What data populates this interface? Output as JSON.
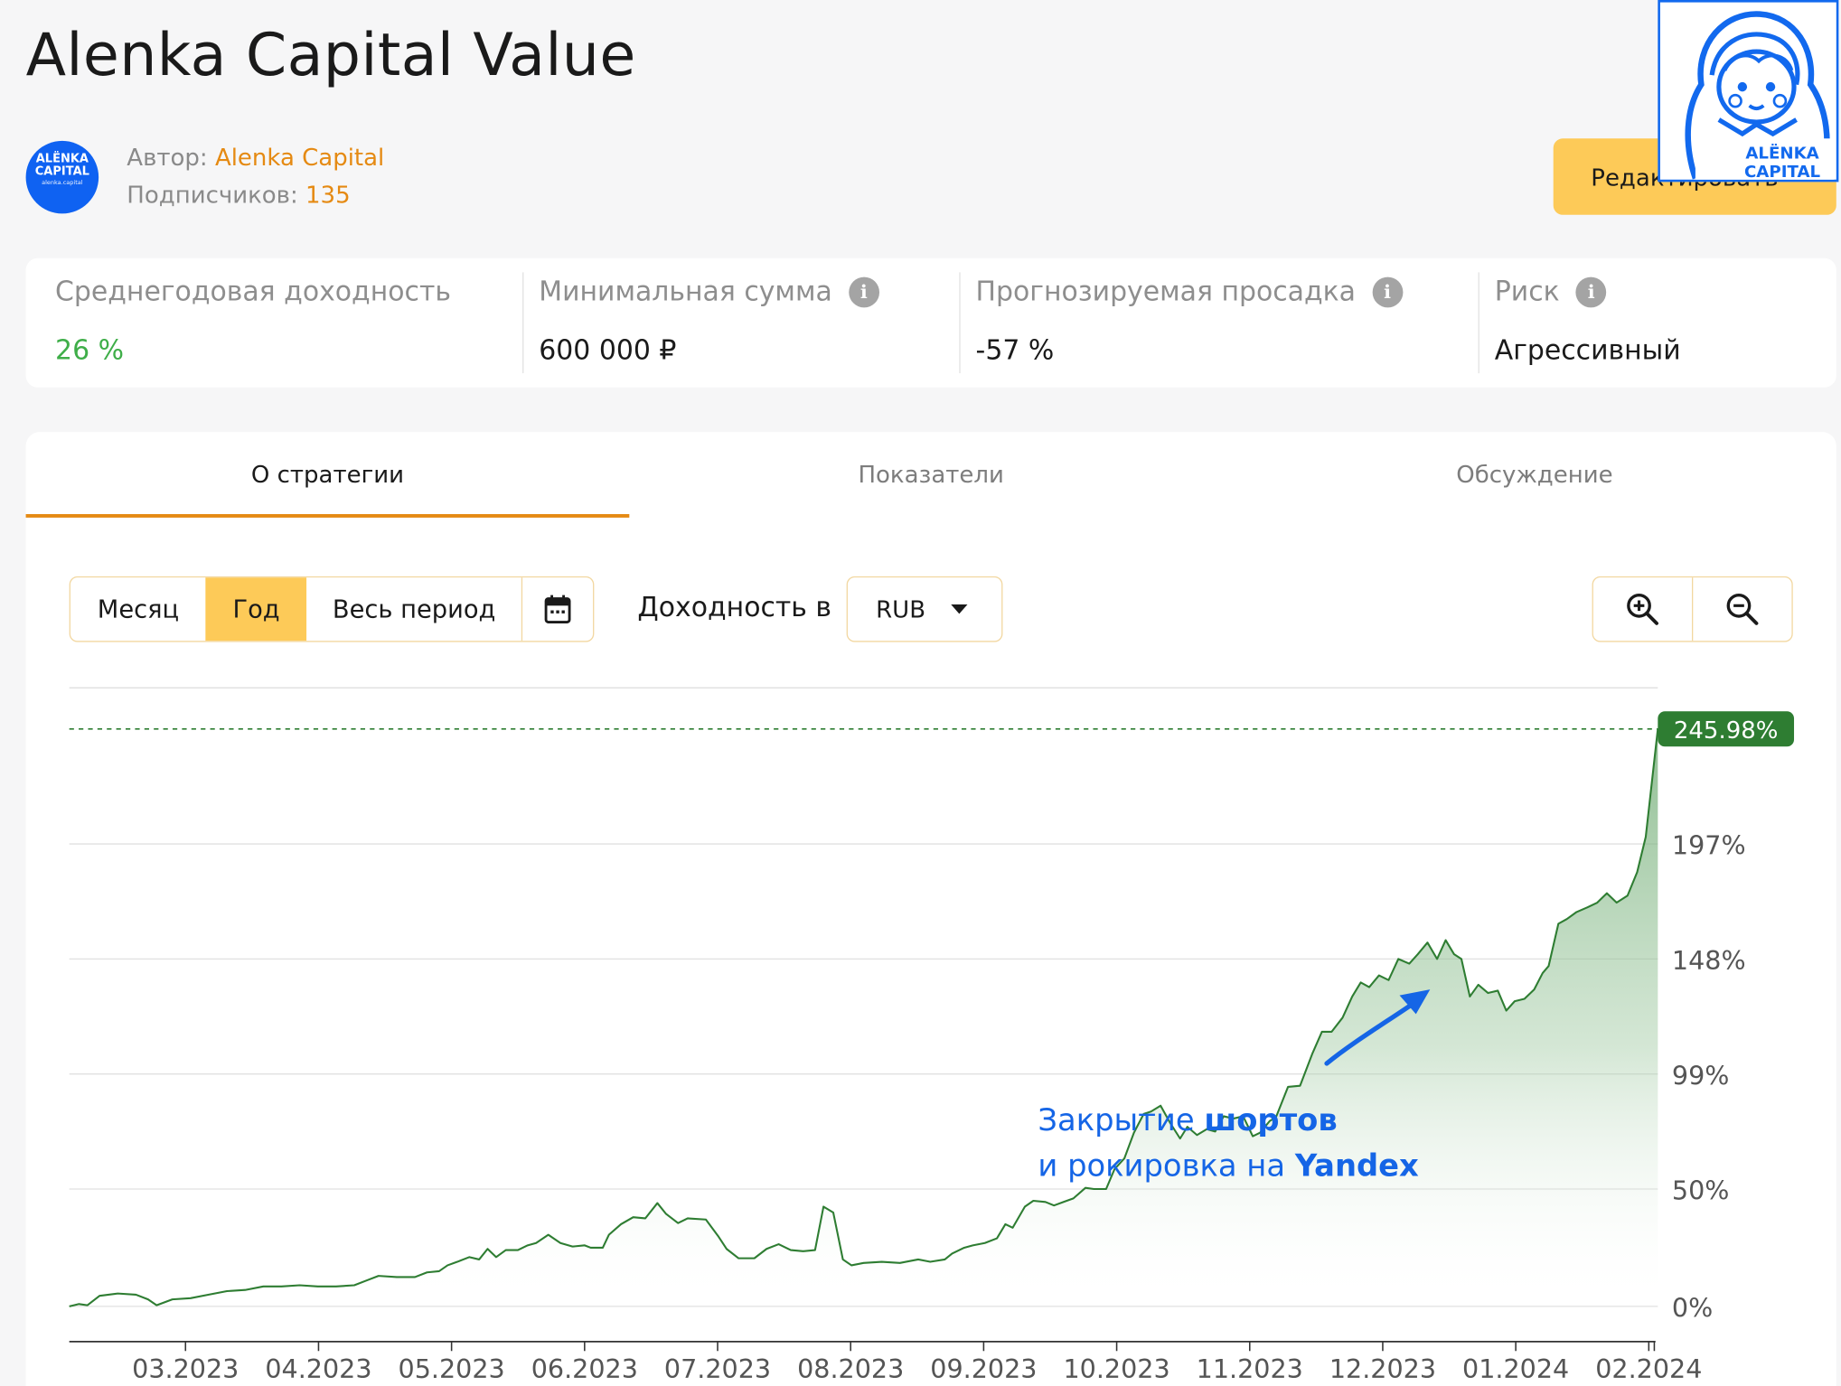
{
  "page": {
    "title": "Alenka Capital Value"
  },
  "author": {
    "avatar_line1": "ALËNKA",
    "avatar_line2": "CAPITAL",
    "avatar_line3": "alenka.capital",
    "author_label": "Автор: ",
    "author_name": "Alenka Capital",
    "subscribers_label": "Подписчиков: ",
    "subscribers_count": "135"
  },
  "edit_button": "Редактировать",
  "logo": {
    "line1": "ALËNKA",
    "line2": "CAPITAL"
  },
  "stats": [
    {
      "label": "Среднегодовая доходность",
      "value": "26 %",
      "value_color": "#3fae49",
      "info": false
    },
    {
      "label": "Минимальная сумма",
      "value": "600 000 ₽",
      "value_color": "#1a1a1a",
      "info": true
    },
    {
      "label": "Прогнозируемая просадка",
      "value": "-57 %",
      "value_color": "#1a1a1a",
      "info": true
    },
    {
      "label": "Риск",
      "value": "Агрессивный",
      "value_color": "#1a1a1a",
      "info": true
    }
  ],
  "tabs": [
    {
      "label": "О стратегии",
      "active": true
    },
    {
      "label": "Показатели",
      "active": false
    },
    {
      "label": "Обсуждение",
      "active": false
    }
  ],
  "periods": [
    {
      "label": "Месяц",
      "selected": false
    },
    {
      "label": "Год",
      "selected": true
    },
    {
      "label": "Весь период",
      "selected": false
    }
  ],
  "calendar_icon": "calendar-icon",
  "yield_label": "Доходность в",
  "currency": "RUB",
  "zoom_icons": [
    "zoom-in-icon",
    "zoom-out-icon"
  ],
  "chart_data": {
    "type": "area",
    "y_unit": "%",
    "y_ticks": [
      0,
      50,
      99,
      148,
      197
    ],
    "y_tick_labels": [
      "0%",
      "50%",
      "99%",
      "148%",
      "197%"
    ],
    "ylim": [
      -10,
      260
    ],
    "x_tick_labels": [
      "03.2023",
      "04.2023",
      "05.2023",
      "06.2023",
      "07.2023",
      "08.2023",
      "09.2023",
      "10.2023",
      "11.2023",
      "12.2023",
      "01.2024",
      "02.2024"
    ],
    "x_range_months": [
      0,
      12.15
    ],
    "last_value_label": "245.98%",
    "last_value": 245.98,
    "series_color": "#2e7d32",
    "annotation": {
      "line1_prefix": "Закрытие ",
      "line1_bold": "шортов",
      "line2_prefix": "и рокировка на ",
      "line2_bold": "Yandex",
      "color": "#1565e6"
    },
    "points": [
      [
        0.0,
        0.0
      ],
      [
        0.08,
        1.0
      ],
      [
        0.15,
        0.5
      ],
      [
        0.25,
        4.5
      ],
      [
        0.4,
        5.5
      ],
      [
        0.55,
        5.0
      ],
      [
        0.65,
        3.0
      ],
      [
        0.72,
        0.5
      ],
      [
        0.85,
        3.0
      ],
      [
        1.0,
        3.5
      ],
      [
        1.15,
        5.0
      ],
      [
        1.3,
        6.5
      ],
      [
        1.45,
        7.0
      ],
      [
        1.6,
        8.5
      ],
      [
        1.75,
        8.5
      ],
      [
        1.9,
        9.0
      ],
      [
        2.05,
        8.5
      ],
      [
        2.2,
        8.5
      ],
      [
        2.35,
        9.0
      ],
      [
        2.45,
        11.0
      ],
      [
        2.55,
        13.0
      ],
      [
        2.7,
        12.5
      ],
      [
        2.85,
        12.5
      ],
      [
        2.95,
        14.5
      ],
      [
        3.05,
        15.0
      ],
      [
        3.12,
        17.5
      ],
      [
        3.2,
        19.0
      ],
      [
        3.3,
        21.0
      ],
      [
        3.38,
        20.0
      ],
      [
        3.45,
        24.5
      ],
      [
        3.52,
        21.0
      ],
      [
        3.6,
        24.0
      ],
      [
        3.7,
        24.0
      ],
      [
        3.78,
        26.0
      ],
      [
        3.85,
        27.0
      ],
      [
        3.95,
        30.5
      ],
      [
        4.05,
        27.0
      ],
      [
        4.15,
        25.5
      ],
      [
        4.25,
        26.0
      ],
      [
        4.3,
        25.0
      ],
      [
        4.4,
        25.0
      ],
      [
        4.45,
        30.5
      ],
      [
        4.55,
        35.0
      ],
      [
        4.65,
        38.0
      ],
      [
        4.75,
        37.5
      ],
      [
        4.85,
        44.0
      ],
      [
        4.92,
        39.5
      ],
      [
        5.02,
        35.5
      ],
      [
        5.1,
        37.5
      ],
      [
        5.25,
        37.0
      ],
      [
        5.35,
        30.0
      ],
      [
        5.42,
        24.5
      ],
      [
        5.52,
        20.5
      ],
      [
        5.65,
        20.5
      ],
      [
        5.75,
        24.5
      ],
      [
        5.85,
        26.5
      ],
      [
        5.95,
        24.0
      ],
      [
        6.05,
        23.5
      ],
      [
        6.15,
        24.0
      ],
      [
        6.22,
        42.5
      ],
      [
        6.3,
        40.0
      ],
      [
        6.38,
        20.0
      ],
      [
        6.45,
        17.5
      ],
      [
        6.55,
        18.5
      ],
      [
        6.7,
        19.0
      ],
      [
        6.85,
        18.5
      ],
      [
        7.0,
        20.0
      ],
      [
        7.1,
        19.0
      ],
      [
        7.22,
        20.0
      ],
      [
        7.28,
        22.5
      ],
      [
        7.38,
        25.0
      ],
      [
        7.45,
        26.0
      ],
      [
        7.55,
        27.0
      ],
      [
        7.65,
        29.0
      ],
      [
        7.72,
        35.0
      ],
      [
        7.78,
        33.5
      ],
      [
        7.88,
        42.5
      ],
      [
        7.95,
        45.0
      ],
      [
        8.05,
        44.5
      ],
      [
        8.12,
        43.0
      ],
      [
        8.2,
        44.5
      ],
      [
        8.28,
        46.0
      ],
      [
        8.38,
        50.5
      ],
      [
        8.45,
        50.0
      ],
      [
        8.55,
        50.0
      ],
      [
        8.62,
        58.5
      ],
      [
        8.7,
        63.0
      ],
      [
        8.78,
        74.0
      ],
      [
        8.86,
        82.0
      ],
      [
        8.92,
        83.0
      ],
      [
        9.0,
        85.5
      ],
      [
        9.08,
        78.0
      ],
      [
        9.16,
        71.5
      ],
      [
        9.22,
        76.5
      ],
      [
        9.3,
        73.0
      ],
      [
        9.38,
        75.5
      ],
      [
        9.45,
        74.5
      ],
      [
        9.52,
        81.0
      ],
      [
        9.6,
        80.0
      ],
      [
        9.68,
        81.0
      ],
      [
        9.76,
        72.5
      ],
      [
        9.82,
        74.0
      ],
      [
        9.9,
        79.0
      ],
      [
        9.95,
        80.5
      ],
      [
        10.05,
        93.5
      ],
      [
        10.15,
        94.0
      ],
      [
        10.25,
        107.5
      ],
      [
        10.33,
        117.0
      ],
      [
        10.41,
        117.0
      ],
      [
        10.5,
        123.0
      ],
      [
        10.58,
        132.0
      ],
      [
        10.65,
        138.0
      ],
      [
        10.72,
        136.0
      ],
      [
        10.8,
        141.0
      ],
      [
        10.88,
        139.0
      ],
      [
        10.96,
        148.0
      ],
      [
        11.05,
        146.0
      ],
      [
        11.12,
        150.0
      ],
      [
        11.2,
        155.0
      ],
      [
        11.28,
        148.0
      ],
      [
        11.35,
        156.0
      ],
      [
        11.42,
        150.0
      ],
      [
        11.48,
        148.0
      ],
      [
        11.55,
        132.0
      ],
      [
        11.62,
        137.0
      ],
      [
        11.7,
        133.5
      ],
      [
        11.78,
        134.5
      ],
      [
        11.85,
        126.0
      ],
      [
        11.92,
        130.0
      ],
      [
        12.0,
        131.0
      ],
      [
        12.08,
        135.0
      ],
      [
        12.15,
        142.0
      ],
      [
        12.2,
        145.0
      ],
      [
        12.28,
        163.0
      ],
      [
        12.35,
        165.0
      ],
      [
        12.43,
        168.0
      ],
      [
        12.52,
        170.0
      ],
      [
        12.6,
        172.0
      ],
      [
        12.68,
        176.0
      ],
      [
        12.76,
        172.0
      ],
      [
        12.85,
        175.0
      ],
      [
        12.93,
        185.0
      ],
      [
        13.0,
        200.0
      ],
      [
        13.1,
        245.98
      ]
    ]
  }
}
